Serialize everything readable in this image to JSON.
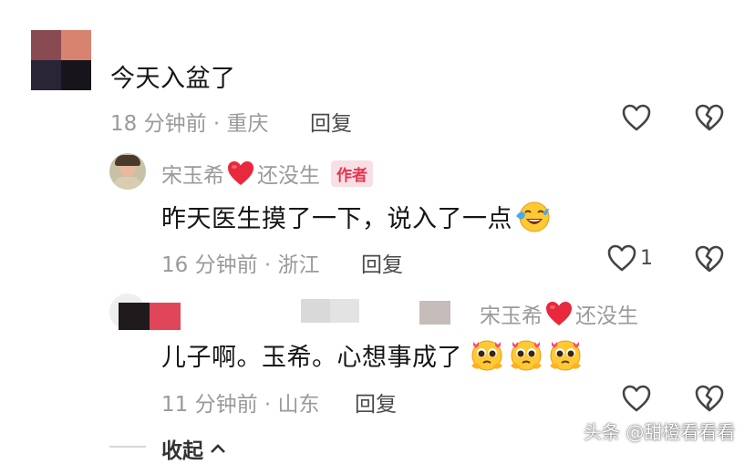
{
  "comment1": {
    "text": "今天入盆了",
    "time_location": "18 分钟前 · 重庆",
    "reply_label": "回复"
  },
  "reply1": {
    "author_prefix": "宋玉希",
    "author_suffix": "还没生",
    "author_badge": "作者",
    "text": "昨天医生摸了一下，说入了一点",
    "time_location": "16 分钟前 · 浙江",
    "reply_label": "回复",
    "like_count": "1"
  },
  "reply2": {
    "reply_to_prefix": "宋玉希",
    "reply_to_suffix": "还没生",
    "text": "儿子啊。玉希。心想事成了",
    "time_location": "11 分钟前 · 山东",
    "reply_label": "回复"
  },
  "collapse_label": "收起",
  "watermark": "头条 @甜橙看看看",
  "icons": {
    "like": "heart-outline-icon",
    "dislike": "broken-heart-icon",
    "heart": "red-heart-icon",
    "cry_laugh": "crying-laughing-emoji",
    "pleading": "pleading-face-emoji",
    "collapse": "chevron-up-icon"
  },
  "colors": {
    "badge_text": "#e5344f",
    "badge_bg": "#f7dfe4",
    "heart": "#e8283d",
    "meta": "#9a9a9a"
  }
}
